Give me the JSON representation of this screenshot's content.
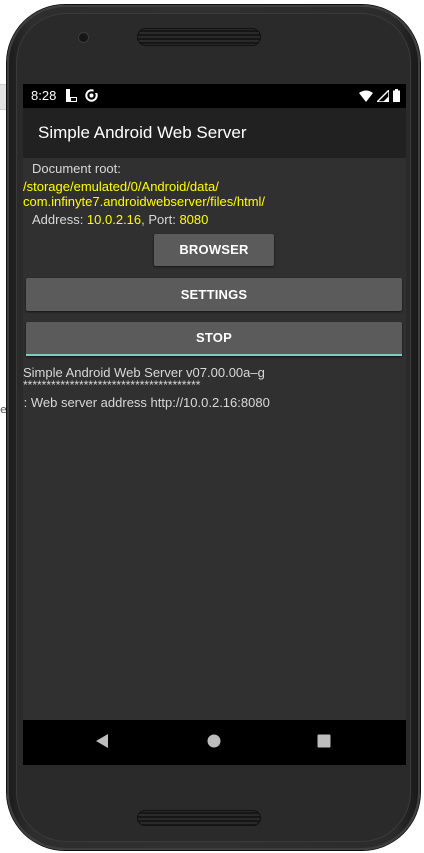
{
  "status_bar": {
    "time": "8:28",
    "icons_left": [
      "sim-card-icon",
      "sync-icon"
    ],
    "icons_right": [
      "wifi-icon",
      "cellular-signal-icon",
      "battery-icon"
    ]
  },
  "app_bar": {
    "title": "Simple Android Web Server"
  },
  "main": {
    "doc_root_label": "Document root:",
    "doc_root_path_line1": "/storage/emulated/0/Android/data/",
    "doc_root_path_line2": "com.infinyte7.androidwebserver/files/html/",
    "address_label": "Address: ",
    "address_value": "10.0.2.16",
    "port_label": ", Port: ",
    "port_value": "8080",
    "buttons": {
      "browser": "BROWSER",
      "settings": "SETTINGS",
      "stop": "STOP"
    },
    "log": {
      "line1": "Simple Android Web Server v07.00.00a–g",
      "line2": "**************************************",
      "line3": "I: Web server address http://10.0.2.16:8080"
    }
  },
  "nav_bar": {
    "icons": [
      "back-icon",
      "home-icon",
      "recents-icon"
    ]
  },
  "colors": {
    "accent_yellow": "#ffff00",
    "stop_underline": "#80cbc4",
    "button_bg": "#5b5b5b",
    "app_bar_bg": "#212121",
    "content_bg": "#303030"
  }
}
